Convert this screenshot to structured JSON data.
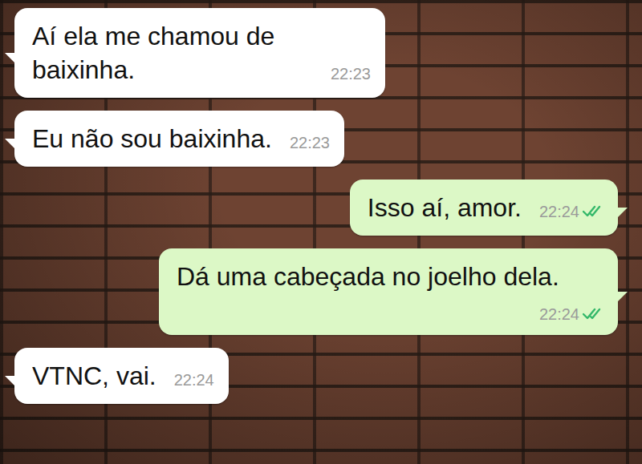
{
  "messages": [
    {
      "kind": "incoming",
      "text": "Aí ela me chamou de baixinha.",
      "time": "22:23"
    },
    {
      "kind": "incoming",
      "text": "Eu não sou baixinha.",
      "time": "22:23"
    },
    {
      "kind": "outgoing",
      "text": "Isso aí, amor.",
      "time": "22:24",
      "read": true
    },
    {
      "kind": "outgoing",
      "text": "Dá uma cabeçada no joelho dela.",
      "time": "22:24",
      "read": true
    },
    {
      "kind": "incoming",
      "text": "VTNC, vai.",
      "time": "22:24"
    }
  ]
}
